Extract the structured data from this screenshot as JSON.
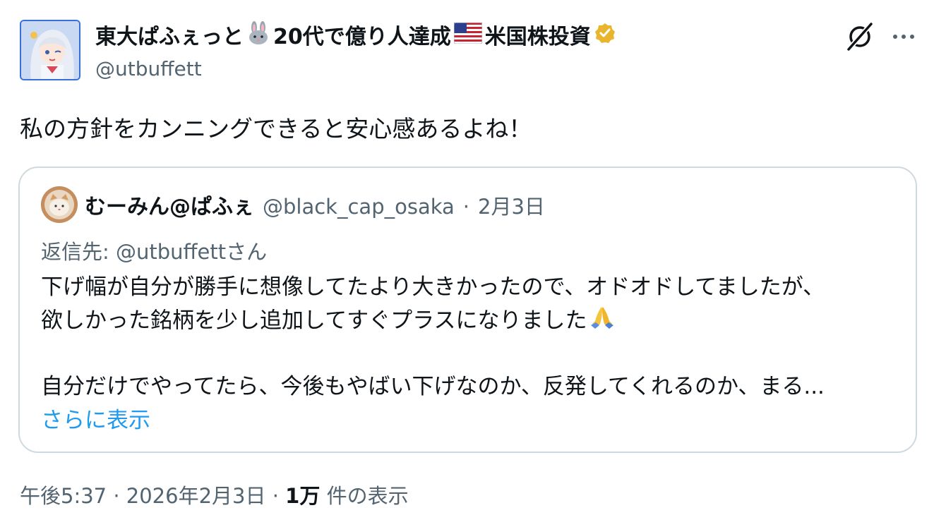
{
  "tweet": {
    "author_name_part1": "東大ぱふぇっと",
    "author_name_part2": "20代で億り人達成",
    "author_name_part3": "米国株投資",
    "handle": "@utbuffett",
    "text": "私の方針をカンニングできると安心感あるよね！",
    "time": "午後5:37",
    "date": "2026年2月3日",
    "views_count": "1万",
    "views_label": "件の表示",
    "separator": "·"
  },
  "quote": {
    "author_name": "むーみん@ぱふぇ",
    "handle": "@black_cap_osaka",
    "date": "2月3日",
    "separator": "·",
    "reply_prefix": "返信先: ",
    "reply_user": "@utbuffettさん",
    "body_lines": [
      "下げ幅が自分が勝手に想像してたより大きかったので、オドオドしてましたが、",
      "欲しかった銘柄を少し追加してすぐプラスになりました",
      "",
      "自分だけでやってたら、今後もやばい下げなのか、反発してくれるのか、まる..."
    ],
    "show_more": "さらに表示"
  },
  "icons": {
    "rabbit": "rabbit-emoji-icon",
    "flag": "us-flag-icon",
    "verified": "verified-badge-icon",
    "grok": "grok-icon",
    "more": "more-icon",
    "pray": "folded-hands-icon"
  },
  "colors": {
    "link": "#1d9bf0",
    "secondary": "#536471",
    "verified": "#e8b52c"
  }
}
